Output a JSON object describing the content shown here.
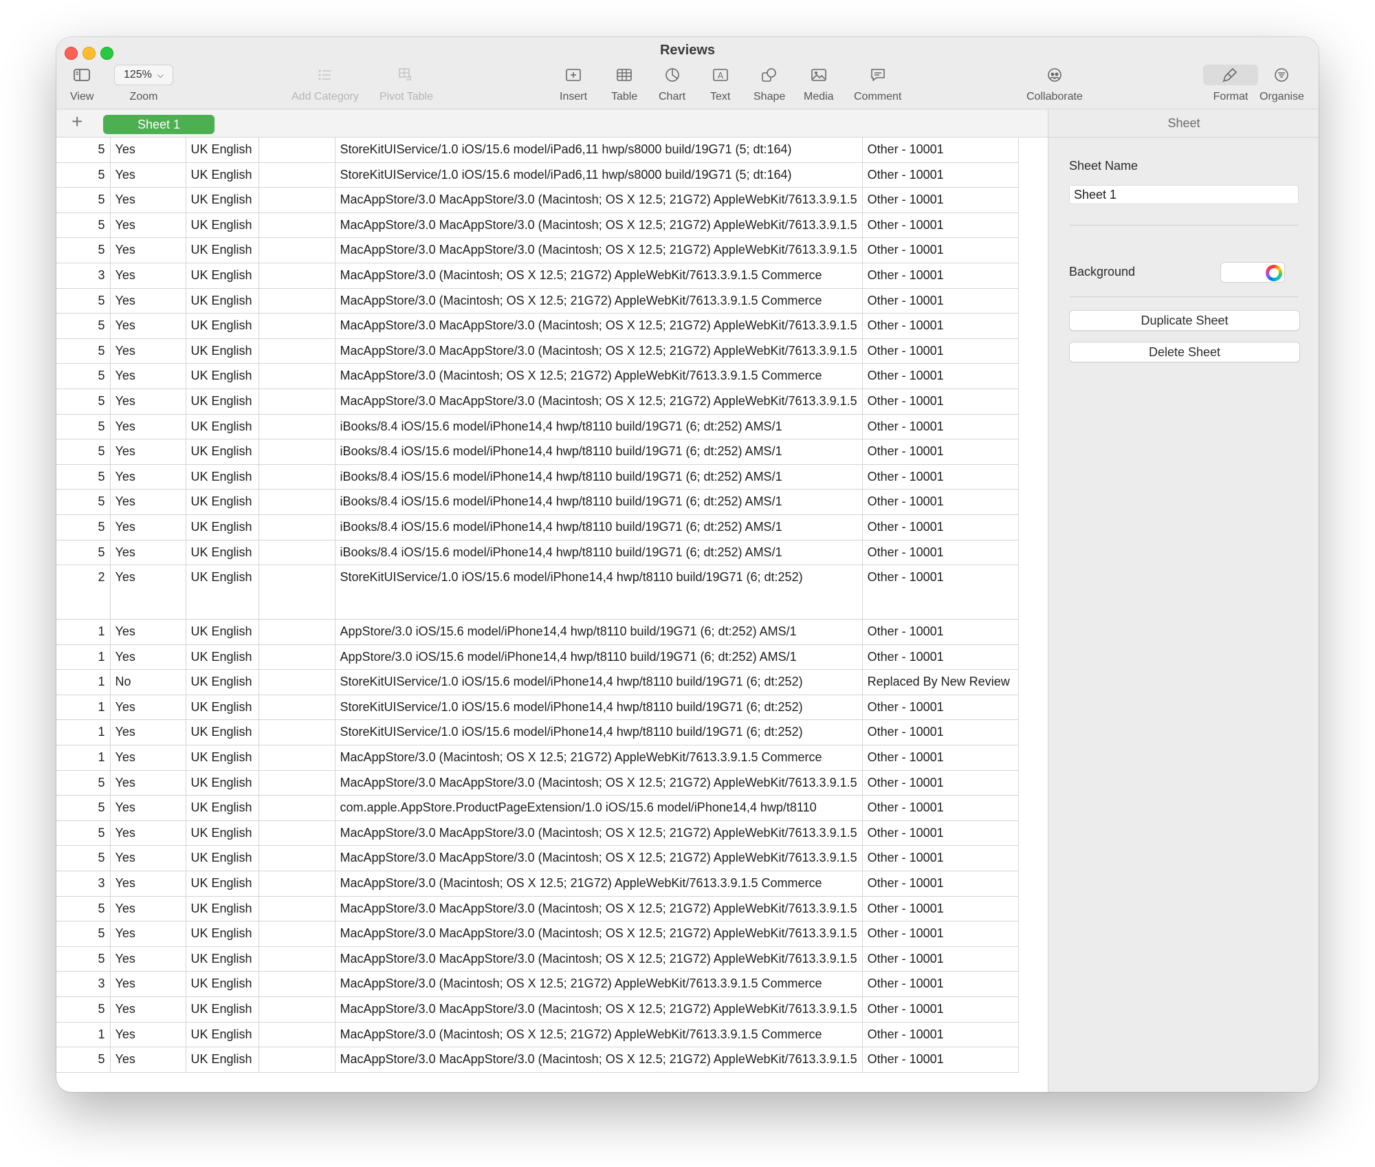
{
  "window": {
    "title": "Reviews"
  },
  "toolbar": {
    "view": "View",
    "zoom_value": "125%",
    "zoom": "Zoom",
    "add_category": "Add Category",
    "pivot_table": "Pivot Table",
    "insert": "Insert",
    "table": "Table",
    "chart": "Chart",
    "text": "Text",
    "shape": "Shape",
    "media": "Media",
    "comment": "Comment",
    "collaborate": "Collaborate",
    "format": "Format",
    "organise": "Organise"
  },
  "tabs": {
    "add": "+",
    "sheet1": "Sheet 1"
  },
  "sidebar": {
    "header": "Sheet",
    "sheet_name_label": "Sheet Name",
    "sheet_name_value": "Sheet 1",
    "background_label": "Background",
    "duplicate": "Duplicate Sheet",
    "delete": "Delete Sheet"
  },
  "rows": [
    {
      "rating": "5",
      "ok": "Yes",
      "lang": "UK English",
      "ua": "StoreKitUIService/1.0 iOS/15.6 model/iPad6,11 hwp/s8000 build/19G71 (5; dt:164)",
      "status": "Other - 10001"
    },
    {
      "rating": "5",
      "ok": "Yes",
      "lang": "UK English",
      "ua": "StoreKitUIService/1.0 iOS/15.6 model/iPad6,11 hwp/s8000 build/19G71 (5; dt:164)",
      "status": "Other - 10001"
    },
    {
      "rating": "5",
      "ok": "Yes",
      "lang": "UK English",
      "ua": "MacAppStore/3.0 MacAppStore/3.0 (Macintosh; OS X 12.5; 21G72) AppleWebKit/7613.3.9.1.5",
      "status": "Other - 10001"
    },
    {
      "rating": "5",
      "ok": "Yes",
      "lang": "UK English",
      "ua": "MacAppStore/3.0 MacAppStore/3.0 (Macintosh; OS X 12.5; 21G72) AppleWebKit/7613.3.9.1.5",
      "status": "Other - 10001"
    },
    {
      "rating": "5",
      "ok": "Yes",
      "lang": "UK English",
      "ua": "MacAppStore/3.0 MacAppStore/3.0 (Macintosh; OS X 12.5; 21G72) AppleWebKit/7613.3.9.1.5",
      "status": "Other - 10001"
    },
    {
      "rating": "3",
      "ok": "Yes",
      "lang": "UK English",
      "ua": "MacAppStore/3.0 (Macintosh; OS X 12.5; 21G72) AppleWebKit/7613.3.9.1.5 Commerce",
      "status": "Other - 10001"
    },
    {
      "rating": "5",
      "ok": "Yes",
      "lang": "UK English",
      "ua": "MacAppStore/3.0 (Macintosh; OS X 12.5; 21G72) AppleWebKit/7613.3.9.1.5 Commerce",
      "status": "Other - 10001"
    },
    {
      "rating": "5",
      "ok": "Yes",
      "lang": "UK English",
      "ua": "MacAppStore/3.0 MacAppStore/3.0 (Macintosh; OS X 12.5; 21G72) AppleWebKit/7613.3.9.1.5",
      "status": "Other - 10001"
    },
    {
      "rating": "5",
      "ok": "Yes",
      "lang": "UK English",
      "ua": "MacAppStore/3.0 MacAppStore/3.0 (Macintosh; OS X 12.5; 21G72) AppleWebKit/7613.3.9.1.5",
      "status": "Other - 10001"
    },
    {
      "rating": "5",
      "ok": "Yes",
      "lang": "UK English",
      "ua": "MacAppStore/3.0 (Macintosh; OS X 12.5; 21G72) AppleWebKit/7613.3.9.1.5 Commerce",
      "status": "Other - 10001"
    },
    {
      "rating": "5",
      "ok": "Yes",
      "lang": "UK English",
      "ua": "MacAppStore/3.0 MacAppStore/3.0 (Macintosh; OS X 12.5; 21G72) AppleWebKit/7613.3.9.1.5",
      "status": "Other - 10001"
    },
    {
      "rating": "5",
      "ok": "Yes",
      "lang": "UK English",
      "ua": "iBooks/8.4 iOS/15.6 model/iPhone14,4 hwp/t8110 build/19G71 (6; dt:252) AMS/1",
      "status": "Other - 10001"
    },
    {
      "rating": "5",
      "ok": "Yes",
      "lang": "UK English",
      "ua": "iBooks/8.4 iOS/15.6 model/iPhone14,4 hwp/t8110 build/19G71 (6; dt:252) AMS/1",
      "status": "Other - 10001"
    },
    {
      "rating": "5",
      "ok": "Yes",
      "lang": "UK English",
      "ua": "iBooks/8.4 iOS/15.6 model/iPhone14,4 hwp/t8110 build/19G71 (6; dt:252) AMS/1",
      "status": "Other - 10001"
    },
    {
      "rating": "5",
      "ok": "Yes",
      "lang": "UK English",
      "ua": "iBooks/8.4 iOS/15.6 model/iPhone14,4 hwp/t8110 build/19G71 (6; dt:252) AMS/1",
      "status": "Other - 10001"
    },
    {
      "rating": "5",
      "ok": "Yes",
      "lang": "UK English",
      "ua": "iBooks/8.4 iOS/15.6 model/iPhone14,4 hwp/t8110 build/19G71 (6; dt:252) AMS/1",
      "status": "Other - 10001"
    },
    {
      "rating": "5",
      "ok": "Yes",
      "lang": "UK English",
      "ua": "iBooks/8.4 iOS/15.6 model/iPhone14,4 hwp/t8110 build/19G71 (6; dt:252) AMS/1",
      "status": "Other - 10001"
    },
    {
      "rating": "2",
      "ok": "Yes",
      "lang": "UK English",
      "ua": "StoreKitUIService/1.0 iOS/15.6 model/iPhone14,4 hwp/t8110 build/19G71 (6; dt:252)",
      "status": "Other - 10001",
      "tall": true
    },
    {
      "rating": "1",
      "ok": "Yes",
      "lang": "UK English",
      "ua": "AppStore/3.0 iOS/15.6 model/iPhone14,4 hwp/t8110 build/19G71 (6; dt:252) AMS/1",
      "status": "Other - 10001"
    },
    {
      "rating": "1",
      "ok": "Yes",
      "lang": "UK English",
      "ua": "AppStore/3.0 iOS/15.6 model/iPhone14,4 hwp/t8110 build/19G71 (6; dt:252) AMS/1",
      "status": "Other - 10001"
    },
    {
      "rating": "1",
      "ok": "No",
      "lang": "UK English",
      "ua": "StoreKitUIService/1.0 iOS/15.6 model/iPhone14,4 hwp/t8110 build/19G71 (6; dt:252)",
      "status": "Replaced By New Review"
    },
    {
      "rating": "1",
      "ok": "Yes",
      "lang": "UK English",
      "ua": "StoreKitUIService/1.0 iOS/15.6 model/iPhone14,4 hwp/t8110 build/19G71 (6; dt:252)",
      "status": "Other - 10001"
    },
    {
      "rating": "1",
      "ok": "Yes",
      "lang": "UK English",
      "ua": "StoreKitUIService/1.0 iOS/15.6 model/iPhone14,4 hwp/t8110 build/19G71 (6; dt:252)",
      "status": "Other - 10001"
    },
    {
      "rating": "1",
      "ok": "Yes",
      "lang": "UK English",
      "ua": "MacAppStore/3.0 (Macintosh; OS X 12.5; 21G72) AppleWebKit/7613.3.9.1.5 Commerce",
      "status": "Other - 10001"
    },
    {
      "rating": "5",
      "ok": "Yes",
      "lang": "UK English",
      "ua": "MacAppStore/3.0 MacAppStore/3.0 (Macintosh; OS X 12.5; 21G72) AppleWebKit/7613.3.9.1.5",
      "status": "Other - 10001"
    },
    {
      "rating": "5",
      "ok": "Yes",
      "lang": "UK English",
      "ua": "com.apple.AppStore.ProductPageExtension/1.0 iOS/15.6 model/iPhone14,4 hwp/t8110",
      "status": "Other - 10001"
    },
    {
      "rating": "5",
      "ok": "Yes",
      "lang": "UK English",
      "ua": "MacAppStore/3.0 MacAppStore/3.0 (Macintosh; OS X 12.5; 21G72) AppleWebKit/7613.3.9.1.5",
      "status": "Other - 10001"
    },
    {
      "rating": "5",
      "ok": "Yes",
      "lang": "UK English",
      "ua": "MacAppStore/3.0 MacAppStore/3.0 (Macintosh; OS X 12.5; 21G72) AppleWebKit/7613.3.9.1.5",
      "status": "Other - 10001"
    },
    {
      "rating": "3",
      "ok": "Yes",
      "lang": "UK English",
      "ua": "MacAppStore/3.0 (Macintosh; OS X 12.5; 21G72) AppleWebKit/7613.3.9.1.5 Commerce",
      "status": "Other - 10001"
    },
    {
      "rating": "5",
      "ok": "Yes",
      "lang": "UK English",
      "ua": "MacAppStore/3.0 MacAppStore/3.0 (Macintosh; OS X 12.5; 21G72) AppleWebKit/7613.3.9.1.5",
      "status": "Other - 10001"
    },
    {
      "rating": "5",
      "ok": "Yes",
      "lang": "UK English",
      "ua": "MacAppStore/3.0 MacAppStore/3.0 (Macintosh; OS X 12.5; 21G72) AppleWebKit/7613.3.9.1.5",
      "status": "Other - 10001"
    },
    {
      "rating": "5",
      "ok": "Yes",
      "lang": "UK English",
      "ua": "MacAppStore/3.0 MacAppStore/3.0 (Macintosh; OS X 12.5; 21G72) AppleWebKit/7613.3.9.1.5",
      "status": "Other - 10001"
    },
    {
      "rating": "3",
      "ok": "Yes",
      "lang": "UK English",
      "ua": "MacAppStore/3.0 (Macintosh; OS X 12.5; 21G72) AppleWebKit/7613.3.9.1.5 Commerce",
      "status": "Other - 10001"
    },
    {
      "rating": "5",
      "ok": "Yes",
      "lang": "UK English",
      "ua": "MacAppStore/3.0 MacAppStore/3.0 (Macintosh; OS X 12.5; 21G72) AppleWebKit/7613.3.9.1.5",
      "status": "Other - 10001"
    },
    {
      "rating": "1",
      "ok": "Yes",
      "lang": "UK English",
      "ua": "MacAppStore/3.0 (Macintosh; OS X 12.5; 21G72) AppleWebKit/7613.3.9.1.5 Commerce",
      "status": "Other - 10001"
    },
    {
      "rating": "5",
      "ok": "Yes",
      "lang": "UK English",
      "ua": "MacAppStore/3.0 MacAppStore/3.0 (Macintosh; OS X 12.5; 21G72) AppleWebKit/7613.3.9.1.5",
      "status": "Other - 10001"
    }
  ]
}
